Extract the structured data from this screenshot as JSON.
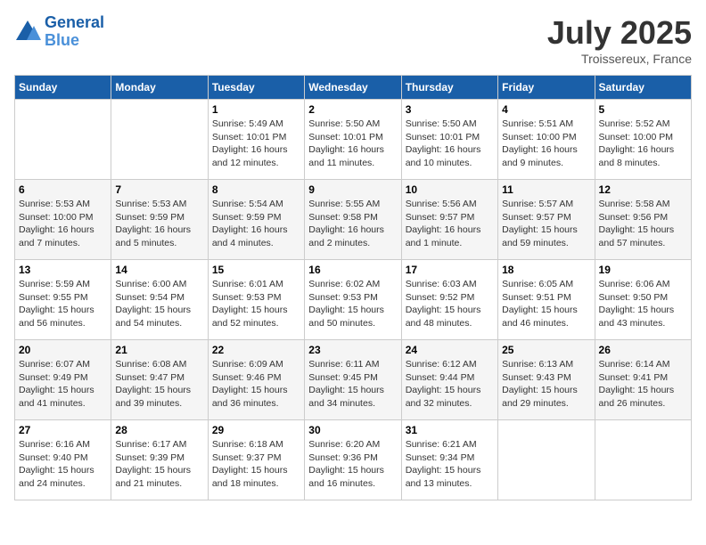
{
  "header": {
    "logo_line1": "General",
    "logo_line2": "Blue",
    "month": "July 2025",
    "location": "Troissereux, France"
  },
  "weekdays": [
    "Sunday",
    "Monday",
    "Tuesday",
    "Wednesday",
    "Thursday",
    "Friday",
    "Saturday"
  ],
  "weeks": [
    [
      {
        "day": "",
        "info": ""
      },
      {
        "day": "",
        "info": ""
      },
      {
        "day": "1",
        "info": "Sunrise: 5:49 AM\nSunset: 10:01 PM\nDaylight: 16 hours\nand 12 minutes."
      },
      {
        "day": "2",
        "info": "Sunrise: 5:50 AM\nSunset: 10:01 PM\nDaylight: 16 hours\nand 11 minutes."
      },
      {
        "day": "3",
        "info": "Sunrise: 5:50 AM\nSunset: 10:01 PM\nDaylight: 16 hours\nand 10 minutes."
      },
      {
        "day": "4",
        "info": "Sunrise: 5:51 AM\nSunset: 10:00 PM\nDaylight: 16 hours\nand 9 minutes."
      },
      {
        "day": "5",
        "info": "Sunrise: 5:52 AM\nSunset: 10:00 PM\nDaylight: 16 hours\nand 8 minutes."
      }
    ],
    [
      {
        "day": "6",
        "info": "Sunrise: 5:53 AM\nSunset: 10:00 PM\nDaylight: 16 hours\nand 7 minutes."
      },
      {
        "day": "7",
        "info": "Sunrise: 5:53 AM\nSunset: 9:59 PM\nDaylight: 16 hours\nand 5 minutes."
      },
      {
        "day": "8",
        "info": "Sunrise: 5:54 AM\nSunset: 9:59 PM\nDaylight: 16 hours\nand 4 minutes."
      },
      {
        "day": "9",
        "info": "Sunrise: 5:55 AM\nSunset: 9:58 PM\nDaylight: 16 hours\nand 2 minutes."
      },
      {
        "day": "10",
        "info": "Sunrise: 5:56 AM\nSunset: 9:57 PM\nDaylight: 16 hours\nand 1 minute."
      },
      {
        "day": "11",
        "info": "Sunrise: 5:57 AM\nSunset: 9:57 PM\nDaylight: 15 hours\nand 59 minutes."
      },
      {
        "day": "12",
        "info": "Sunrise: 5:58 AM\nSunset: 9:56 PM\nDaylight: 15 hours\nand 57 minutes."
      }
    ],
    [
      {
        "day": "13",
        "info": "Sunrise: 5:59 AM\nSunset: 9:55 PM\nDaylight: 15 hours\nand 56 minutes."
      },
      {
        "day": "14",
        "info": "Sunrise: 6:00 AM\nSunset: 9:54 PM\nDaylight: 15 hours\nand 54 minutes."
      },
      {
        "day": "15",
        "info": "Sunrise: 6:01 AM\nSunset: 9:53 PM\nDaylight: 15 hours\nand 52 minutes."
      },
      {
        "day": "16",
        "info": "Sunrise: 6:02 AM\nSunset: 9:53 PM\nDaylight: 15 hours\nand 50 minutes."
      },
      {
        "day": "17",
        "info": "Sunrise: 6:03 AM\nSunset: 9:52 PM\nDaylight: 15 hours\nand 48 minutes."
      },
      {
        "day": "18",
        "info": "Sunrise: 6:05 AM\nSunset: 9:51 PM\nDaylight: 15 hours\nand 46 minutes."
      },
      {
        "day": "19",
        "info": "Sunrise: 6:06 AM\nSunset: 9:50 PM\nDaylight: 15 hours\nand 43 minutes."
      }
    ],
    [
      {
        "day": "20",
        "info": "Sunrise: 6:07 AM\nSunset: 9:49 PM\nDaylight: 15 hours\nand 41 minutes."
      },
      {
        "day": "21",
        "info": "Sunrise: 6:08 AM\nSunset: 9:47 PM\nDaylight: 15 hours\nand 39 minutes."
      },
      {
        "day": "22",
        "info": "Sunrise: 6:09 AM\nSunset: 9:46 PM\nDaylight: 15 hours\nand 36 minutes."
      },
      {
        "day": "23",
        "info": "Sunrise: 6:11 AM\nSunset: 9:45 PM\nDaylight: 15 hours\nand 34 minutes."
      },
      {
        "day": "24",
        "info": "Sunrise: 6:12 AM\nSunset: 9:44 PM\nDaylight: 15 hours\nand 32 minutes."
      },
      {
        "day": "25",
        "info": "Sunrise: 6:13 AM\nSunset: 9:43 PM\nDaylight: 15 hours\nand 29 minutes."
      },
      {
        "day": "26",
        "info": "Sunrise: 6:14 AM\nSunset: 9:41 PM\nDaylight: 15 hours\nand 26 minutes."
      }
    ],
    [
      {
        "day": "27",
        "info": "Sunrise: 6:16 AM\nSunset: 9:40 PM\nDaylight: 15 hours\nand 24 minutes."
      },
      {
        "day": "28",
        "info": "Sunrise: 6:17 AM\nSunset: 9:39 PM\nDaylight: 15 hours\nand 21 minutes."
      },
      {
        "day": "29",
        "info": "Sunrise: 6:18 AM\nSunset: 9:37 PM\nDaylight: 15 hours\nand 18 minutes."
      },
      {
        "day": "30",
        "info": "Sunrise: 6:20 AM\nSunset: 9:36 PM\nDaylight: 15 hours\nand 16 minutes."
      },
      {
        "day": "31",
        "info": "Sunrise: 6:21 AM\nSunset: 9:34 PM\nDaylight: 15 hours\nand 13 minutes."
      },
      {
        "day": "",
        "info": ""
      },
      {
        "day": "",
        "info": ""
      }
    ]
  ]
}
